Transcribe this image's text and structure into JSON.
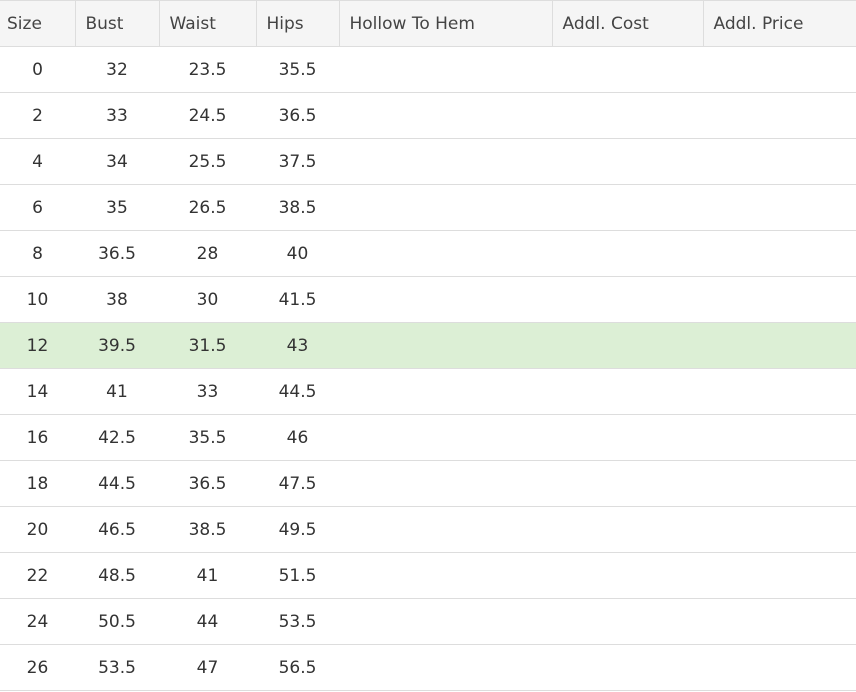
{
  "table": {
    "headers": [
      "Size",
      "Bust",
      "Waist",
      "Hips",
      "Hollow To Hem",
      "Addl. Cost",
      "Addl. Price"
    ],
    "highlighted_row": 6,
    "rows": [
      [
        "0",
        "32",
        "23.5",
        "35.5",
        "",
        "",
        ""
      ],
      [
        "2",
        "33",
        "24.5",
        "36.5",
        "",
        "",
        ""
      ],
      [
        "4",
        "34",
        "25.5",
        "37.5",
        "",
        "",
        ""
      ],
      [
        "6",
        "35",
        "26.5",
        "38.5",
        "",
        "",
        ""
      ],
      [
        "8",
        "36.5",
        "28",
        "40",
        "",
        "",
        ""
      ],
      [
        "10",
        "38",
        "30",
        "41.5",
        "",
        "",
        ""
      ],
      [
        "12",
        "39.5",
        "31.5",
        "43",
        "",
        "",
        ""
      ],
      [
        "14",
        "41",
        "33",
        "44.5",
        "",
        "",
        ""
      ],
      [
        "16",
        "42.5",
        "35.5",
        "46",
        "",
        "",
        ""
      ],
      [
        "18",
        "44.5",
        "36.5",
        "47.5",
        "",
        "",
        ""
      ],
      [
        "20",
        "46.5",
        "38.5",
        "49.5",
        "",
        "",
        ""
      ],
      [
        "22",
        "48.5",
        "41",
        "51.5",
        "",
        "",
        ""
      ],
      [
        "24",
        "50.5",
        "44",
        "53.5",
        "",
        "",
        ""
      ],
      [
        "26",
        "53.5",
        "47",
        "56.5",
        "",
        "",
        ""
      ]
    ]
  },
  "colors": {
    "header_bg": "#f5f5f5",
    "border": "#dddddd",
    "highlight_row": "#dcefd5",
    "text": "#333333"
  }
}
